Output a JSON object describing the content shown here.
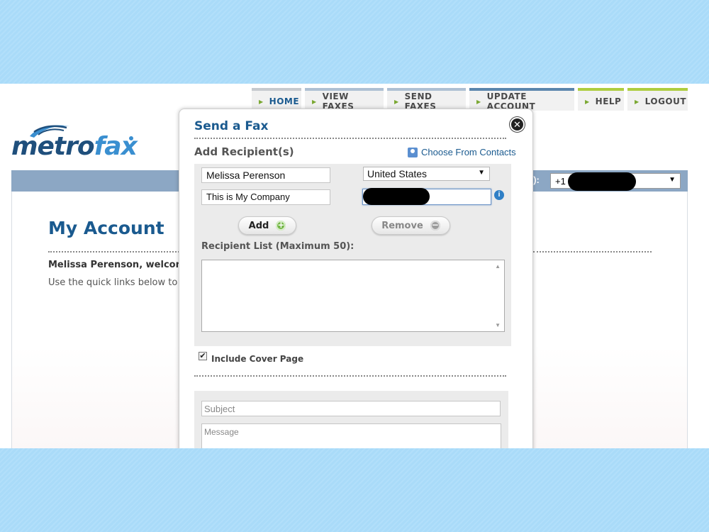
{
  "nav": {
    "tabs": [
      {
        "label": "HOME"
      },
      {
        "label": "VIEW FAXES"
      },
      {
        "label": "SEND FAXES"
      },
      {
        "label": "UPDATE ACCOUNT"
      },
      {
        "label": "HELP"
      },
      {
        "label": "LOGOUT"
      }
    ]
  },
  "logo": {
    "part1": "metro",
    "part2": "fax"
  },
  "phone_bar": {
    "label": "s):",
    "value": "+1"
  },
  "page": {
    "title": "My Account",
    "welcome": "Melissa Perenson, welcome",
    "quick_links_text": "Use the quick links below to a"
  },
  "modal": {
    "title": "Send a Fax",
    "section_title": "Add Recipient(s)",
    "contacts_link": "Choose From Contacts",
    "recipient_name": "Melissa Perenson",
    "company": "This is My Company",
    "country": "United States",
    "add_button": "Add",
    "remove_button": "Remove",
    "list_label": "Recipient List (Maximum 50):",
    "cover_page_label": "Include Cover Page",
    "cover_page_checked": true,
    "subject_placeholder": "Subject",
    "message_placeholder": "Message"
  },
  "colors": {
    "background": "#a9dbf9",
    "brand_blue": "#1a5a8f",
    "bar": "#8ca7c4",
    "accent_green": "#aecd3f"
  }
}
